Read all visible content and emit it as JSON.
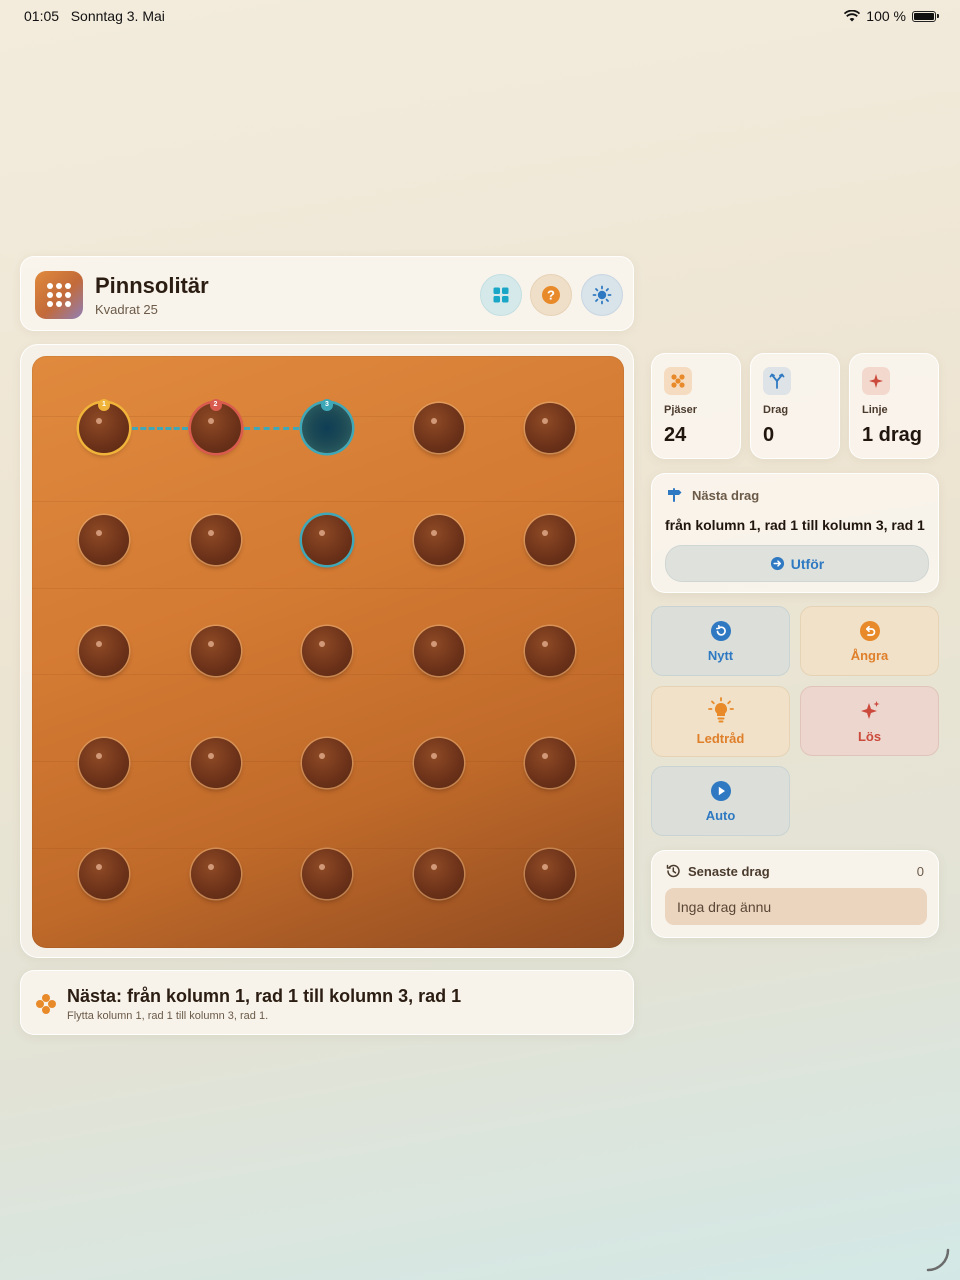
{
  "status_bar": {
    "time": "01:05",
    "date": "Sonntag 3. Mai",
    "battery": "100 %"
  },
  "header": {
    "title": "Pinnsolitär",
    "subtitle": "Kvadrat 25",
    "icons": [
      "grid-icon",
      "help-icon",
      "theme-icon"
    ]
  },
  "board": {
    "rows": 5,
    "cols": 5,
    "empty": [
      [
        0,
        2
      ]
    ],
    "selected": [
      {
        "row": 0,
        "col": 0,
        "badge": "1",
        "color": "#f0b43a"
      },
      {
        "row": 0,
        "col": 1,
        "badge": "2",
        "color": "#d95a4e"
      },
      {
        "row": 0,
        "col": 2,
        "badge": "3",
        "color": "#3fa8b8"
      }
    ],
    "highlight": [
      [
        1,
        2
      ]
    ]
  },
  "hint": {
    "title": "Nästa: från kolumn 1, rad 1 till kolumn 3, rad 1",
    "subtitle": "Flytta kolumn 1, rad 1 till kolumn 3, rad 1."
  },
  "stats": [
    {
      "label": "Pjäser",
      "value": "24"
    },
    {
      "label": "Drag",
      "value": "0"
    },
    {
      "label": "Linje",
      "value": "1 drag"
    }
  ],
  "next_move": {
    "heading": "Nästa drag",
    "text": "från kolumn 1, rad 1 till kolumn 3, rad 1",
    "execute_label": "Utför"
  },
  "actions": {
    "new": "Nytt",
    "undo": "Ångra",
    "hint": "Ledtråd",
    "solve": "Lös",
    "auto": "Auto"
  },
  "recent": {
    "heading": "Senaste drag",
    "count": "0",
    "empty_text": "Inga drag ännu"
  },
  "colors": {
    "accent_blue": "#2f79c2",
    "accent_orange": "#e07f2a",
    "accent_red": "#cc4a3c",
    "board_wood": "#d37a33"
  }
}
